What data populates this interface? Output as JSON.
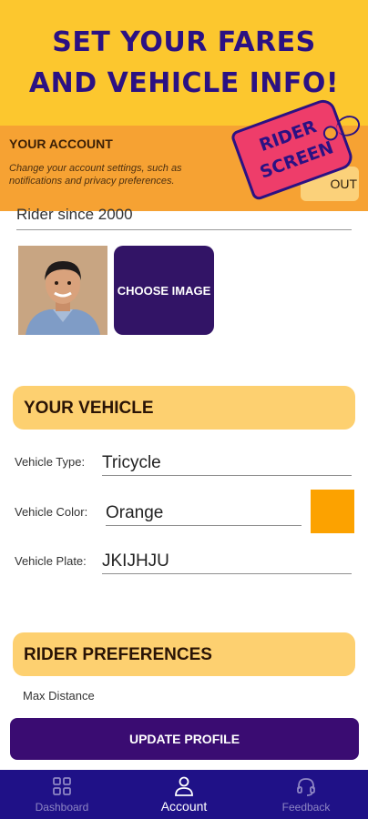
{
  "promo": {
    "line1": "SET YOUR FARES",
    "line2": "AND VEHICLE INFO!",
    "tag_line1": "RIDER",
    "tag_line2": "SCREEN"
  },
  "account": {
    "title": "YOUR ACCOUNT",
    "subtitle": "Change your account settings, such as notifications and privacy preferences.",
    "logout_label": "OUT"
  },
  "profile": {
    "rider_since": "Rider since 2000",
    "choose_image_label": "CHOOSE IMAGE"
  },
  "vehicle": {
    "header": "YOUR VEHICLE",
    "type_label": "Vehicle Type:",
    "type_value": "Tricycle",
    "color_label": "Vehicle Color:",
    "color_value": "Orange",
    "swatch_color": "#fca200",
    "plate_label": "Vehicle Plate:",
    "plate_value": "JKIJHJU"
  },
  "preferences": {
    "header": "RIDER PREFERENCES",
    "max_distance_label": "Max Distance"
  },
  "update_button": "UPDATE PROFILE",
  "nav": [
    {
      "label": "Dashboard",
      "icon": "grid-icon"
    },
    {
      "label": "Account",
      "icon": "person-icon"
    },
    {
      "label": "Feedback",
      "icon": "headset-icon"
    }
  ],
  "colors": {
    "brand_purple": "#2b1183",
    "brand_yellow": "#fcc72e",
    "accent_orange": "#f6a233",
    "nav_bg": "#1f1187"
  }
}
